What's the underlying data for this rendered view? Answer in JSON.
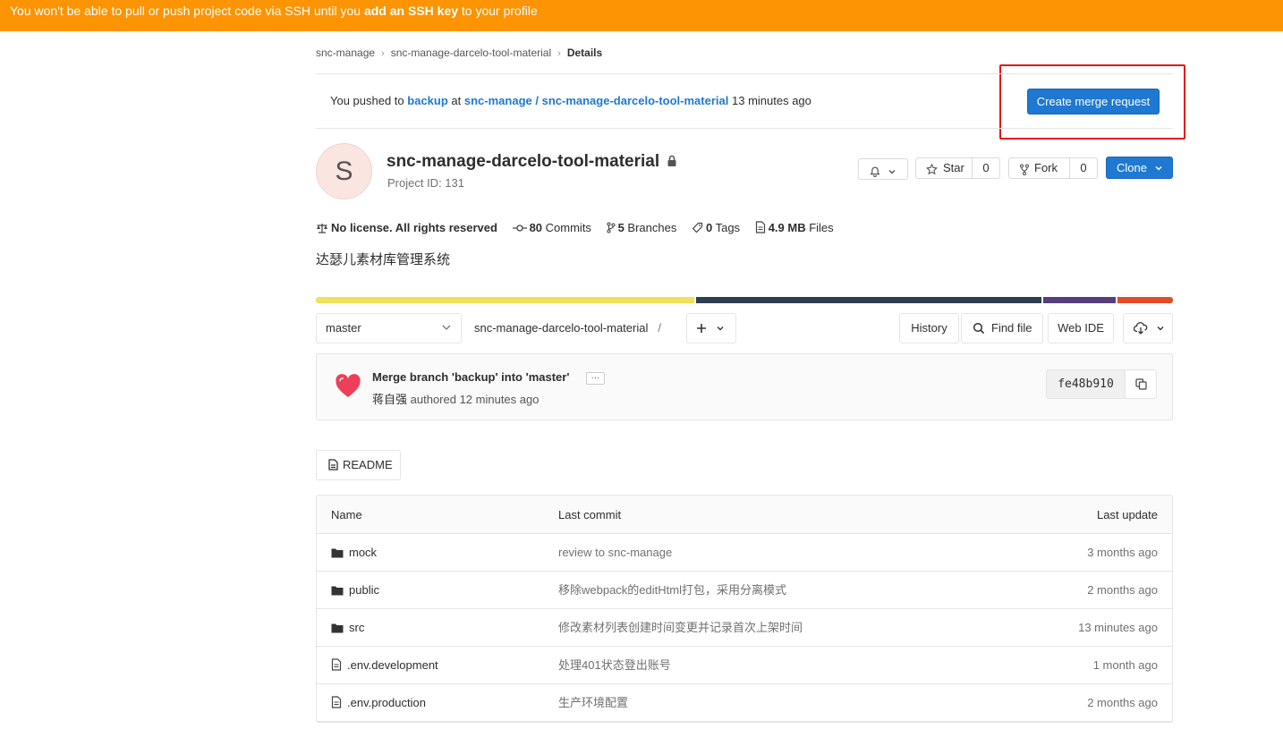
{
  "banner": {
    "prefix": "You won't be able to pull or push project code via SSH until you ",
    "link": "add an SSH key",
    "suffix": " to your profile"
  },
  "breadcrumb": {
    "group": "snc-manage",
    "project": "snc-manage-darcelo-tool-material",
    "current": "Details"
  },
  "push_notice": {
    "prefix": "You pushed to",
    "branch": "backup",
    "at": "at",
    "project_path": "snc-manage / snc-manage-darcelo-tool-material",
    "time": "13 minutes ago",
    "button": "Create merge request"
  },
  "project": {
    "avatar_letter": "S",
    "name": "snc-manage-darcelo-tool-material",
    "id_text": "Project ID: 131",
    "description": "达瑟儿素材库管理系统"
  },
  "actions": {
    "star_label": "Star",
    "star_count": "0",
    "fork_label": "Fork",
    "fork_count": "0",
    "clone_label": "Clone"
  },
  "stats": {
    "license": "No license. All rights reserved",
    "commits_count": "80",
    "commits_label": "Commits",
    "branches_count": "5",
    "branches_label": "Branches",
    "tags_count": "0",
    "tags_label": "Tags",
    "files_size": "4.9 MB",
    "files_label": "Files"
  },
  "language_colors": [
    "#f1e05a",
    "#2c3e50",
    "#563d7c",
    "#e34c26"
  ],
  "repo_toolbar": {
    "branch": "master",
    "path": "snc-manage-darcelo-tool-material",
    "path_sep": "/",
    "history": "History",
    "find_file": "Find file",
    "web_ide": "Web IDE"
  },
  "last_commit": {
    "message": "Merge branch 'backup' into 'master'",
    "ellipsis": "···",
    "author": "蒋自强",
    "authored": "authored 12 minutes ago",
    "sha": "fe48b910"
  },
  "readme_button": "README",
  "file_table": {
    "headers": {
      "name": "Name",
      "last_commit": "Last commit",
      "last_update": "Last update"
    },
    "rows": [
      {
        "type": "folder",
        "name": "mock",
        "commit": "review to snc-manage",
        "updated": "3 months ago"
      },
      {
        "type": "folder",
        "name": "public",
        "commit": "移除webpack的editHtml打包，采用分离模式",
        "updated": "2 months ago"
      },
      {
        "type": "folder",
        "name": "src",
        "commit": "修改素材列表创建时间变更并记录首次上架时间",
        "updated": "13 minutes ago"
      },
      {
        "type": "file",
        "name": ".env.development",
        "commit": "处理401状态登出账号",
        "updated": "1 month ago"
      },
      {
        "type": "file",
        "name": ".env.production",
        "commit": "生产环境配置",
        "updated": "2 months ago"
      }
    ]
  }
}
